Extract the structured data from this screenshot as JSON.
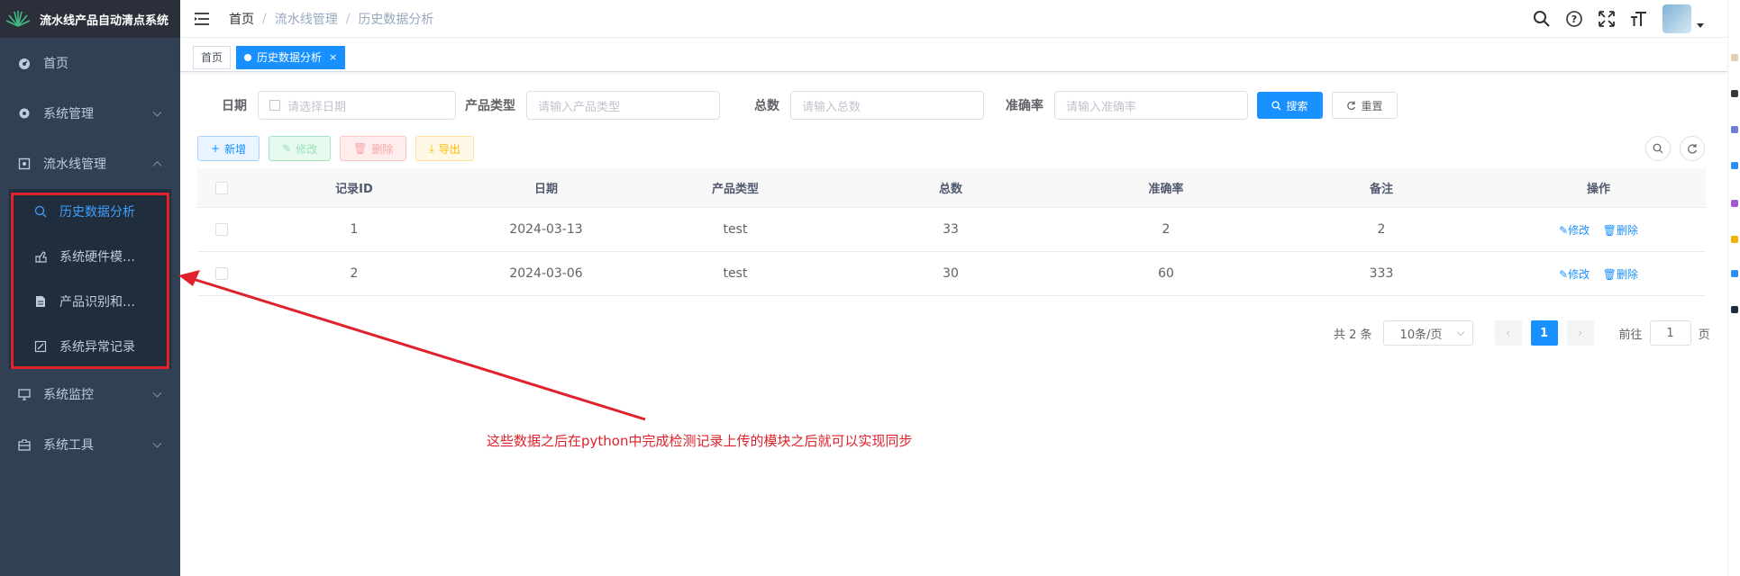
{
  "app": {
    "title": "流水线产品自动清点系统"
  },
  "sidebar": {
    "items": [
      {
        "label": "首页",
        "icon": "dashboard-icon"
      },
      {
        "label": "系统管理",
        "icon": "gear-icon"
      },
      {
        "label": "流水线管理",
        "icon": "monitor-icon"
      },
      {
        "label": "系统监控",
        "icon": "screen-icon"
      },
      {
        "label": "系统工具",
        "icon": "toolbox-icon"
      }
    ],
    "submenu": [
      {
        "label": "历史数据分析",
        "icon": "chart-icon",
        "active": true
      },
      {
        "label": "系统硬件模…",
        "icon": "hardware-icon"
      },
      {
        "label": "产品识别和…",
        "icon": "document-icon"
      },
      {
        "label": "系统异常记录",
        "icon": "edit-icon"
      }
    ]
  },
  "breadcrumb": [
    "首页",
    "流水线管理",
    "历史数据分析"
  ],
  "tags": {
    "home": "首页",
    "current": "历史数据分析",
    "close": "×"
  },
  "search": {
    "date_label": "日期",
    "date_placeholder": "请选择日期",
    "type_label": "产品类型",
    "type_placeholder": "请输入产品类型",
    "total_label": "总数",
    "total_placeholder": "请输入总数",
    "acc_label": "准确率",
    "acc_placeholder": "请输入准确率",
    "search_btn": "搜索",
    "reset_btn": "重置"
  },
  "toolbar": {
    "add": "新增",
    "edit": "修改",
    "delete": "删除",
    "export": "导出"
  },
  "table": {
    "headers": [
      "记录ID",
      "日期",
      "产品类型",
      "总数",
      "准确率",
      "备注",
      "操作"
    ],
    "rows": [
      {
        "id": "1",
        "date": "2024-03-13",
        "type": "test",
        "total": "33",
        "accuracy": "2",
        "note": "2"
      },
      {
        "id": "2",
        "date": "2024-03-06",
        "type": "test",
        "total": "30",
        "accuracy": "60",
        "note": "333"
      }
    ],
    "op_edit": "修改",
    "op_delete": "删除"
  },
  "pagination": {
    "total_text": "共 2 条",
    "page_size": "10条/页",
    "current_page": "1",
    "goto_label": "前往",
    "goto_value": "1",
    "page_suffix": "页"
  },
  "annotation": "这些数据之后在python中完成检测记录上传的模块之后就可以实现同步",
  "colors": {
    "sidebar_bg": "#304156",
    "primary": "#1890ff",
    "annotation_red": "#e0202a"
  }
}
